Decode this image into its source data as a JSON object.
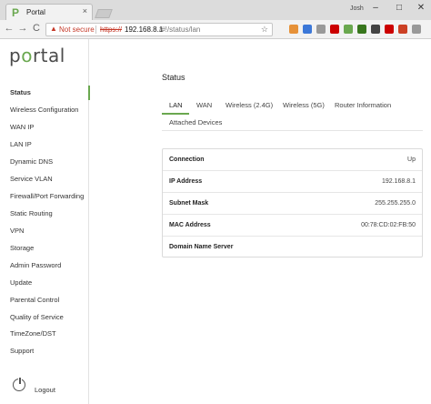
{
  "browser": {
    "tab_title": "Portal",
    "tab_favicon": "P",
    "tab_close": "×",
    "profile_name": "Josh",
    "security_warning": "Not secure",
    "url_scheme": "https://",
    "url_host": "192.168.8.1",
    "url_path": "/#!/status/lan",
    "window_controls": {
      "minimize": "–",
      "maximize": "□",
      "close": "✕"
    },
    "nav": {
      "back": "←",
      "forward": "→",
      "reload": "C"
    },
    "star_icon": "☆",
    "extension_colors": [
      "#e69138",
      "#3c78d8",
      "#999999",
      "#cc0000",
      "#6aa84f",
      "#38761d",
      "#444444",
      "#cc0000",
      "#cc4125",
      "#999999",
      "#3c78d8",
      "#666666"
    ]
  },
  "sidebar": {
    "logo_prefix": "p",
    "logo_o": "o",
    "logo_suffix": "rtal",
    "items": [
      {
        "label": "Status",
        "active": true
      },
      {
        "label": "Wireless Configuration"
      },
      {
        "label": "WAN IP"
      },
      {
        "label": "LAN IP"
      },
      {
        "label": "Dynamic DNS"
      },
      {
        "label": "Service VLAN"
      },
      {
        "label": "Firewall/Port Forwarding"
      },
      {
        "label": "Static Routing"
      },
      {
        "label": "VPN"
      },
      {
        "label": "Storage"
      },
      {
        "label": "Admin Password"
      },
      {
        "label": "Update"
      },
      {
        "label": "Parental Control"
      },
      {
        "label": "Quality of Service"
      },
      {
        "label": "TimeZone/DST"
      },
      {
        "label": "Support"
      }
    ],
    "logout_label": "Logout"
  },
  "main": {
    "title": "Status",
    "tabs": [
      {
        "label": "LAN",
        "active": true
      },
      {
        "label": "WAN"
      },
      {
        "label": "Wireless (2.4G)"
      },
      {
        "label": "Wireless (5G)"
      },
      {
        "label": "Router Information"
      },
      {
        "label": "Attached Devices"
      }
    ],
    "rows": [
      {
        "label": "Connection",
        "value": "Up"
      },
      {
        "label": "IP Address",
        "value": "192.168.8.1"
      },
      {
        "label": "Subnet Mask",
        "value": "255.255.255.0"
      },
      {
        "label": "MAC Address",
        "value": "00:78:CD:02:FB:50"
      },
      {
        "label": "Domain Name Server",
        "value": ""
      }
    ]
  },
  "colors": {
    "accent": "#6aa84f",
    "warning": "#c53929"
  }
}
